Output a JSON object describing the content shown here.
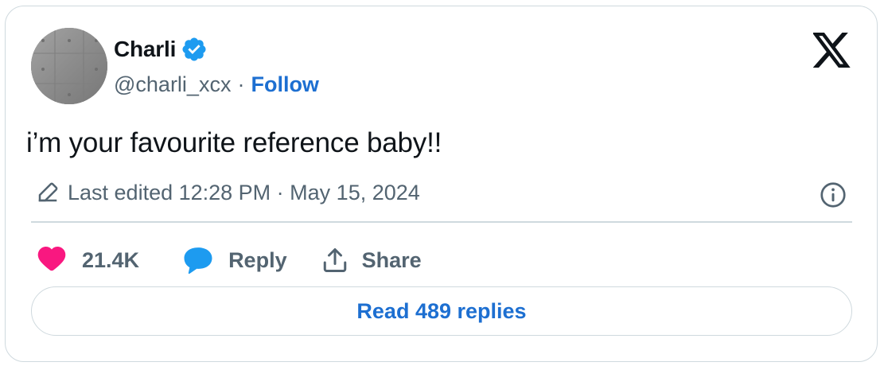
{
  "author": {
    "name": "Charli",
    "handle": "@charli_xcx",
    "separator": "·",
    "follow_label": "Follow",
    "verified": true
  },
  "tweet": {
    "text": "i’m your favourite reference baby!!",
    "edited_text": "Last edited 12:28 PM · May 15, 2024"
  },
  "actions": {
    "like_count": "21.4K",
    "reply_label": "Reply",
    "share_label": "Share"
  },
  "read_replies_label": "Read 489 replies",
  "colors": {
    "link": "#1d6fd1",
    "like": "#f91880",
    "reply_icon": "#1d9bf0",
    "secondary_text": "#536471",
    "border": "#cfd9de"
  },
  "icons": {
    "verified": "verified-badge-icon",
    "brand": "x-logo-icon",
    "edit": "pencil-icon",
    "info": "info-icon",
    "like": "heart-icon",
    "reply": "speech-bubble-icon",
    "share": "share-upload-icon"
  }
}
